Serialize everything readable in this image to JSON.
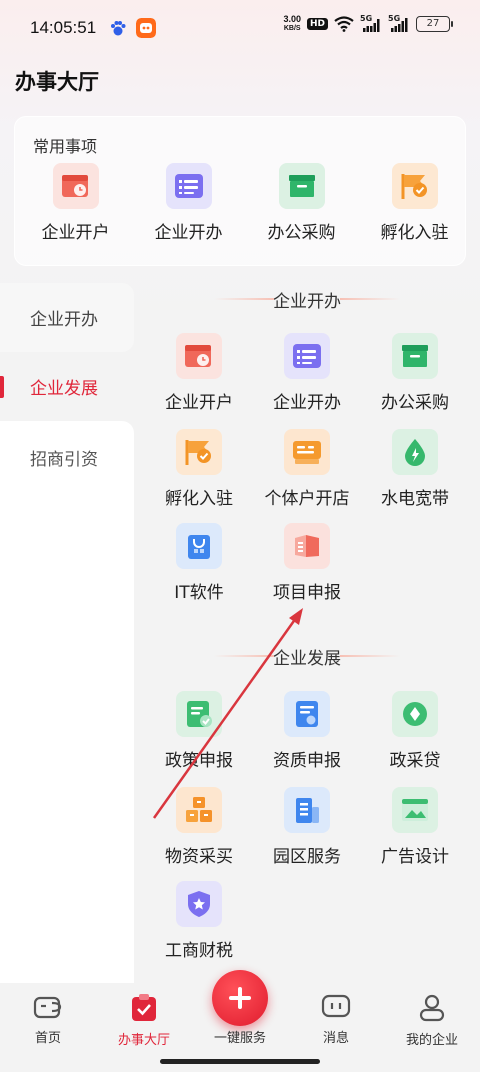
{
  "status_bar": {
    "time": "14:05:51",
    "net_speed_value": "3.00",
    "net_speed_unit": "KB/S",
    "hd": "HD",
    "signal1": "5G",
    "signal2": "5G",
    "battery": "27"
  },
  "page_title": "办事大厅",
  "common": {
    "title": "常用事项",
    "items": [
      {
        "label": "企业开户",
        "icon": "calendar-icon"
      },
      {
        "label": "企业开办",
        "icon": "list-icon"
      },
      {
        "label": "办公采购",
        "icon": "box-icon"
      },
      {
        "label": "孵化入驻",
        "icon": "flag-check-icon"
      }
    ]
  },
  "sidebar": {
    "items": [
      {
        "label": "企业开办"
      },
      {
        "label": "企业发展"
      },
      {
        "label": "招商引资"
      }
    ],
    "active_index": 1
  },
  "sections": [
    {
      "title": "企业开办",
      "items": [
        {
          "label": "企业开户"
        },
        {
          "label": "企业开办"
        },
        {
          "label": "办公采购"
        },
        {
          "label": "孵化入驻"
        },
        {
          "label": "个体户开店"
        },
        {
          "label": "水电宽带"
        },
        {
          "label": "IT软件"
        },
        {
          "label": "项目申报"
        }
      ]
    },
    {
      "title": "企业发展",
      "items": [
        {
          "label": "政策申报"
        },
        {
          "label": "资质申报"
        },
        {
          "label": "政采贷"
        },
        {
          "label": "物资采买"
        },
        {
          "label": "园区服务"
        },
        {
          "label": "广告设计"
        },
        {
          "label": "工商财税"
        }
      ]
    }
  ],
  "bottom_nav": {
    "items": [
      {
        "label": "首页"
      },
      {
        "label": "办事大厅"
      },
      {
        "label": "一键服务"
      },
      {
        "label": "消息"
      },
      {
        "label": "我的企业"
      }
    ],
    "active_index": 1
  },
  "colors": {
    "accent": "#e0263a",
    "text": "#222222",
    "background": "#f3f3f3"
  }
}
